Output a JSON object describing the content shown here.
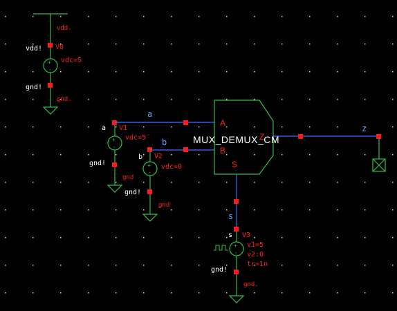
{
  "schematic": {
    "grid_color": "#dcdcdc",
    "background": "#000000",
    "wire_color": "#3a6cff",
    "device_color": "#2fbf4a",
    "pin_color": "#ff1a1a",
    "vdd_label": "vdd.",
    "v0": {
      "net_label": "vdd!",
      "name": "V0",
      "param": "vdc=5",
      "gnd_net": "gnd!",
      "gnd_label": "gnd."
    },
    "v1": {
      "net_label": "a",
      "name": "V1",
      "param": "vdc=5",
      "gnd_net": "gnd!",
      "gnd_label": "gnd"
    },
    "v2": {
      "net_label": "b",
      "name": "V2",
      "param": "vdc=0",
      "gnd_net": "gnd!",
      "gnd_label": "gnd"
    },
    "v3": {
      "net_label": "s",
      "name": "V3",
      "param1": "v1=5",
      "param2": "v2:0",
      "param3": "tr=1n",
      "gnd_net": "gnd!",
      "gnd_label": "gnd."
    },
    "wires": {
      "a": "a",
      "b": "b",
      "s": "s",
      "z": "z"
    },
    "cell": {
      "name": "MUX_DEMUX_CM",
      "pin_a": "A",
      "pin_b": "B",
      "pin_z": "Z",
      "pin_s": "S"
    }
  }
}
